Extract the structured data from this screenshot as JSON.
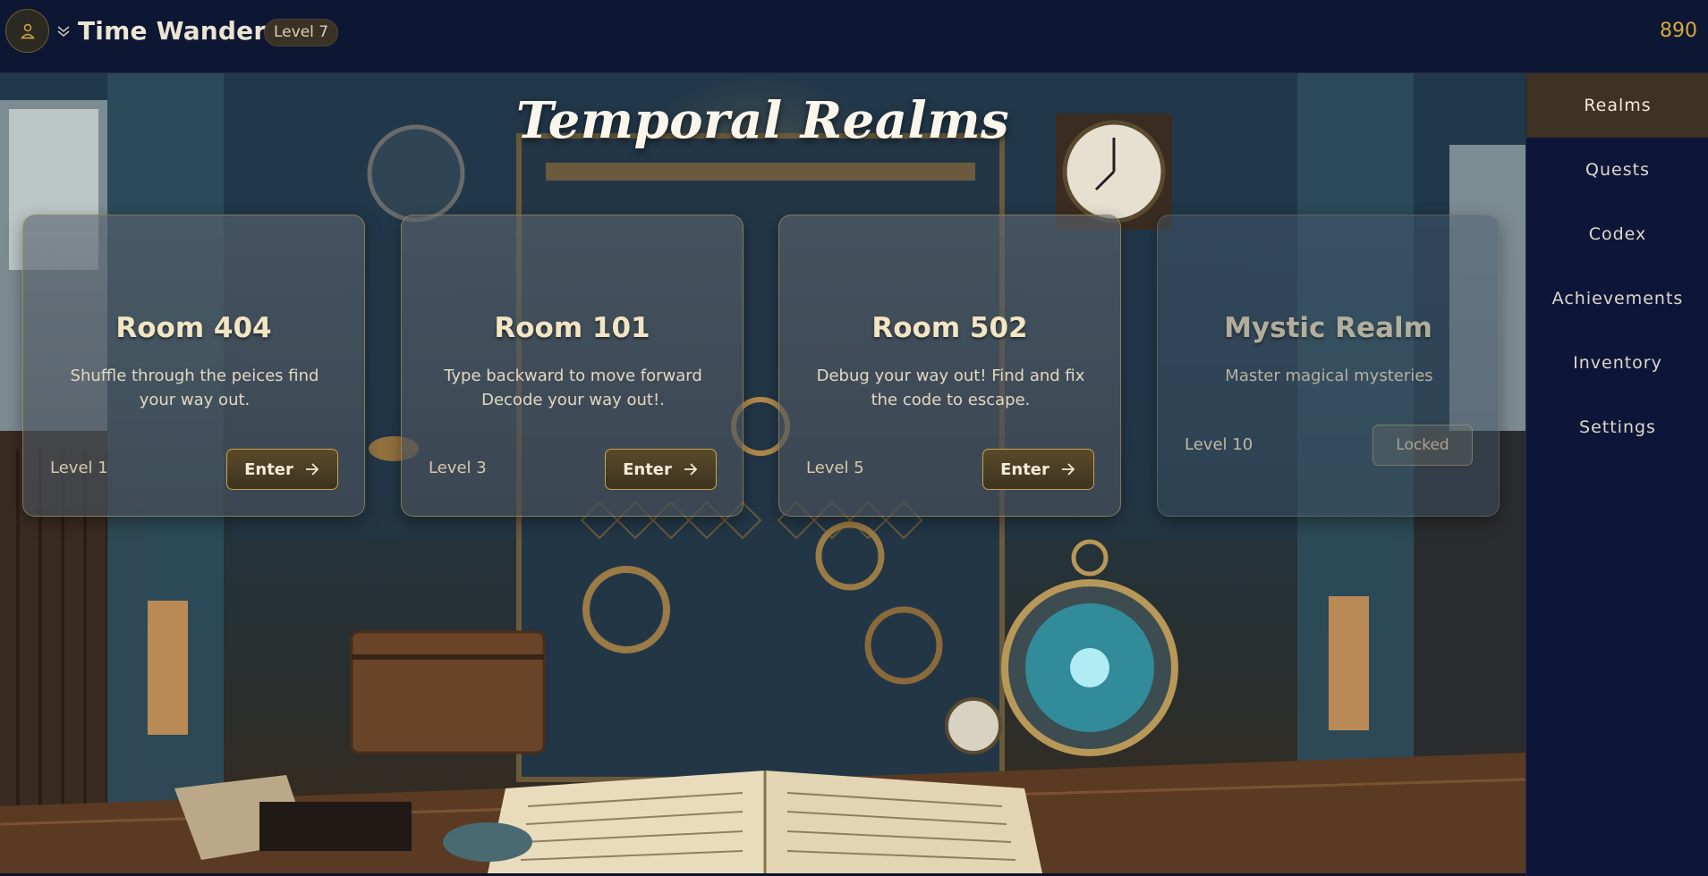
{
  "header": {
    "player_name": "Time Wanderer",
    "level_badge": "Level 7",
    "score": "890"
  },
  "main": {
    "title": "Temporal Realms",
    "rooms": [
      {
        "title": "Room 404",
        "description": "Shuffle through the peices find your way out.",
        "level": "Level 1",
        "button": "Enter",
        "locked": false
      },
      {
        "title": "Room 101",
        "description": "Type backward to move forward Decode your way out!.",
        "level": "Level 3",
        "button": "Enter",
        "locked": false
      },
      {
        "title": "Room 502",
        "description": "Debug your way out! Find and fix the code to escape.",
        "level": "Level 5",
        "button": "Enter",
        "locked": false
      },
      {
        "title": "Mystic Realm",
        "description": "Master magical mysteries",
        "level": "Level 10",
        "button": "Locked",
        "locked": true
      }
    ]
  },
  "sidebar": {
    "items": [
      {
        "label": "Realms",
        "active": true
      },
      {
        "label": "Quests",
        "active": false
      },
      {
        "label": "Codex",
        "active": false
      },
      {
        "label": "Achievements",
        "active": false
      },
      {
        "label": "Inventory",
        "active": false
      },
      {
        "label": "Settings",
        "active": false
      }
    ]
  },
  "colors": {
    "accent_gold": "#d9a93a",
    "header_bg": "#0d1734",
    "sidebar_bg": "#0d1639",
    "active_nav_bg": "#3d3224"
  },
  "icons": {
    "avatar": "user-icon",
    "menu_toggle": "chevron-down-icon",
    "enter": "arrow-right-icon"
  }
}
